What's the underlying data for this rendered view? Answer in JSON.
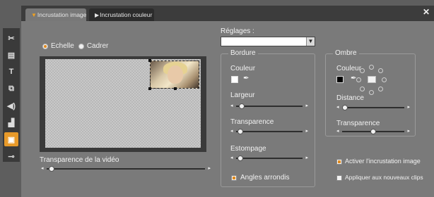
{
  "tabs": {
    "image_label": "Incrustation image",
    "color_label": "Incrustation couleur"
  },
  "icons": {
    "close": "close-icon",
    "tab_arrow_active": "triangle-down-icon",
    "tab_arrow_inactive": "triangle-right-icon",
    "toolbar": [
      "scissors-icon",
      "titles-icon",
      "text-icon",
      "transitions-icon",
      "audio-icon",
      "clapboard-icon",
      "overlay-icon",
      "plug-icon"
    ]
  },
  "colors": {
    "accent": "#e89a2a",
    "panel": "#7a7a7a",
    "frame": "#5e5e5e"
  },
  "mode": {
    "scale_label": "Echelle",
    "frame_label": "Cadrer",
    "selected": "Echelle"
  },
  "video": {
    "transparency_label": "Transparence de la vidéo",
    "transparency_value": 0.03
  },
  "settings": {
    "label": "Réglages :",
    "selected_value": ""
  },
  "border": {
    "title": "Bordure",
    "color_label": "Couleur",
    "color_value": "#ffffff",
    "width_label": "Largeur",
    "width_value": 0.08,
    "transparency_label": "Transparence",
    "transparency_value": 0.06,
    "blur_label": "Estompage",
    "blur_value": 0.06,
    "rounded_label": "Angles arrondis",
    "rounded_checked": true
  },
  "shadow": {
    "title": "Ombre",
    "color_label": "Couleur",
    "color_value": "#000000",
    "distance_label": "Distance",
    "distance_value": 0.04,
    "transparency_label": "Transparence",
    "transparency_value": 0.5,
    "direction": "bottom-right"
  },
  "options": {
    "enable_label": "Activer l'incrustation image",
    "enable_checked": true,
    "apply_new_label": "Appliquer aux nouveaux clips",
    "apply_new_checked": false
  }
}
